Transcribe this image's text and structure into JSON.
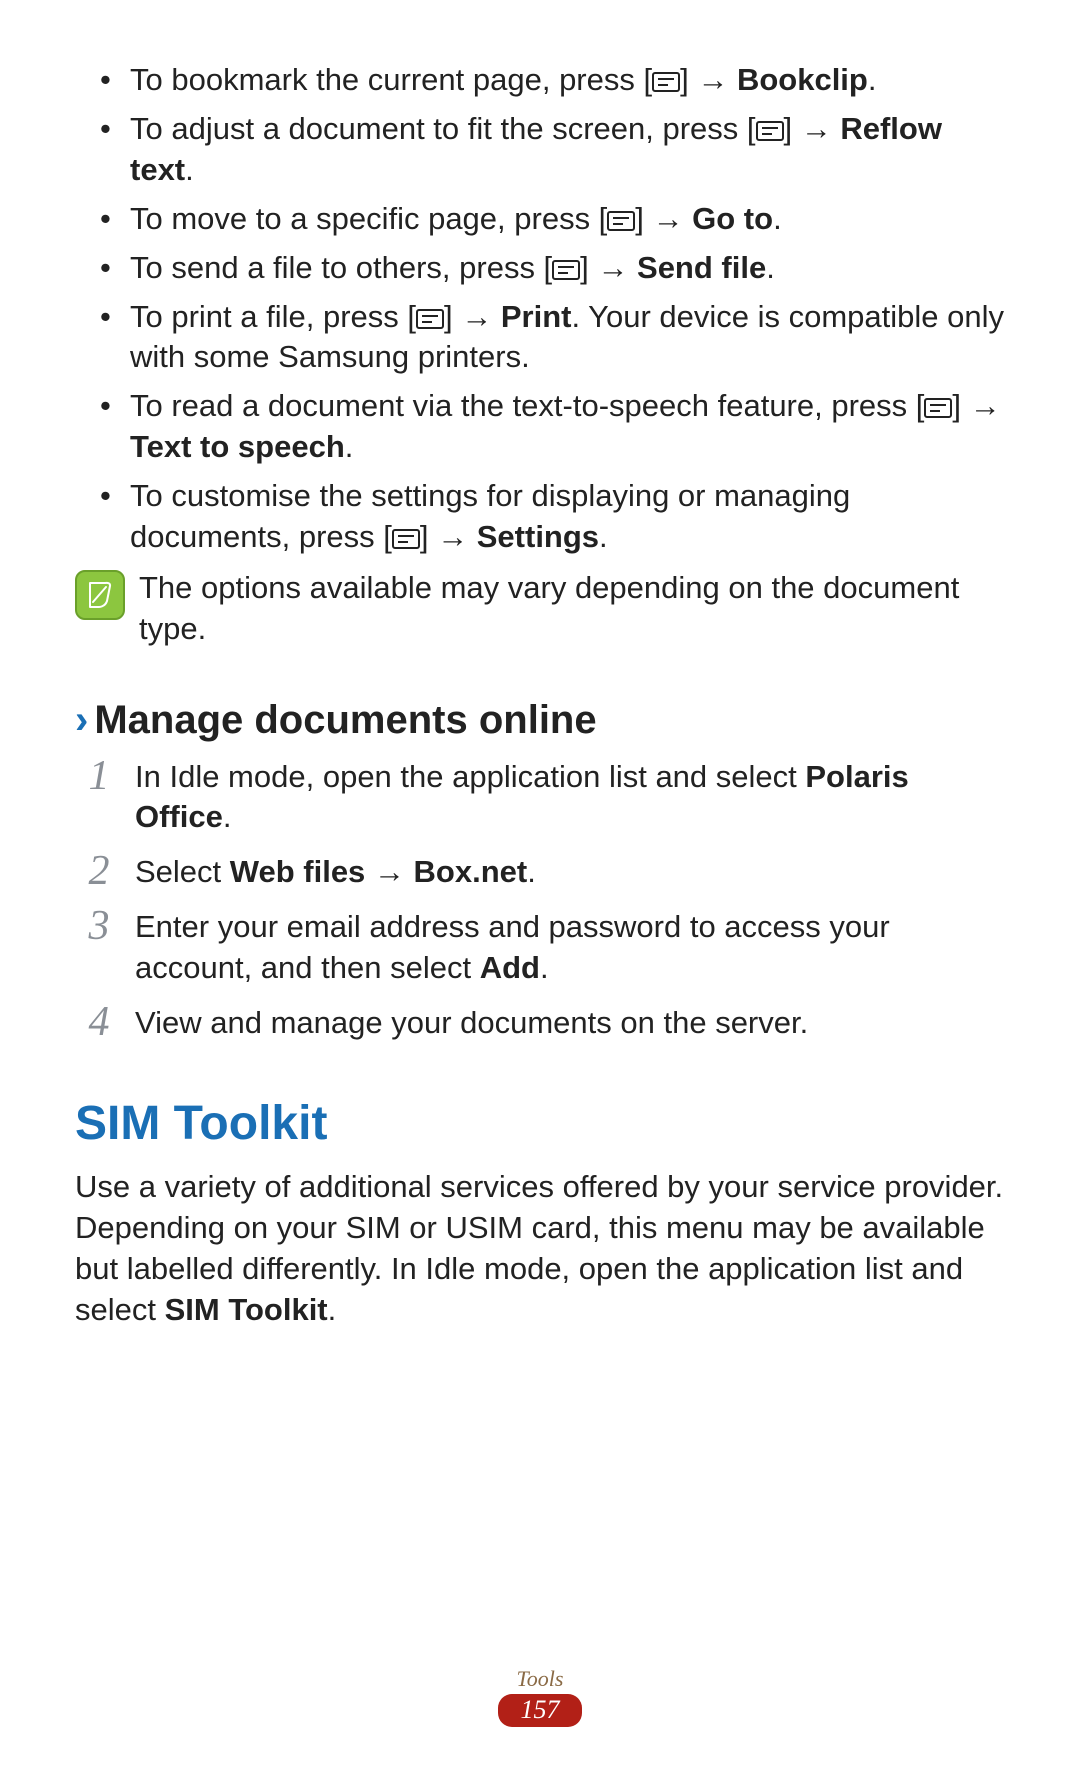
{
  "bullets": [
    {
      "pre": "To bookmark the current page, press [",
      "post": "] → ",
      "bold": "Bookclip",
      "tail": "."
    },
    {
      "pre": "To adjust a document to fit the screen, press [",
      "post": "] → ",
      "bold": "Reflow text",
      "tail": "."
    },
    {
      "pre": "To move to a specific page, press [",
      "post": "] → ",
      "bold": "Go to",
      "tail": "."
    },
    {
      "pre": "To send a file to others, press [",
      "post": "] → ",
      "bold": "Send file",
      "tail": "."
    },
    {
      "pre": "To print a file, press [",
      "post": "] → ",
      "bold": "Print",
      "tail": ". Your device is compatible only with some Samsung printers."
    },
    {
      "pre": "To read a document via the text-to-speech feature, press [",
      "post": "] → ",
      "bold": "Text to speech",
      "tail": "."
    },
    {
      "pre": "To customise the settings for displaying or managing documents, press [",
      "post": "] → ",
      "bold": "Settings",
      "tail": "."
    }
  ],
  "note_text": "The options available may vary depending on the document type.",
  "sub_heading": "Manage documents online",
  "steps": [
    {
      "num": "1",
      "pre": "In Idle mode, open the application list and select ",
      "bold": "Polaris Office",
      "tail": "."
    },
    {
      "num": "2",
      "pre": "Select ",
      "bold": "Web files → Box.net",
      "tail": "."
    },
    {
      "num": "3",
      "pre": "Enter your email address and password to access your account, and then select ",
      "bold": "Add",
      "tail": "."
    },
    {
      "num": "4",
      "pre": "View and manage your documents on the server.",
      "bold": "",
      "tail": ""
    }
  ],
  "h1": "SIM Toolkit",
  "body_pre": "Use a variety of additional services offered by your service provider. Depending on your SIM or USIM card, this menu may be available but labelled differently. In Idle mode, open the application list and select ",
  "body_bold": "SIM Toolkit",
  "body_tail": ".",
  "footer_section": "Tools",
  "page_number": "157"
}
